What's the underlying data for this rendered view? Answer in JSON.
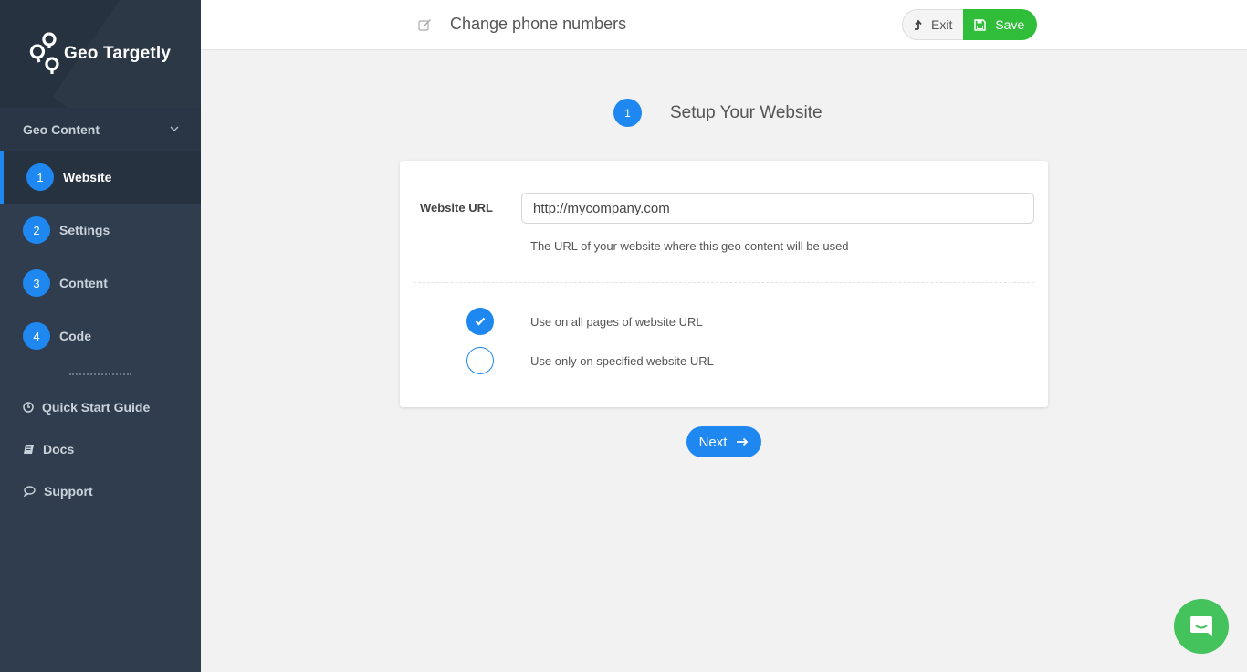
{
  "brand": {
    "name": "Geo Targetly"
  },
  "sidebar": {
    "section_label": "Geo Content",
    "steps": [
      {
        "num": "1",
        "label": "Website"
      },
      {
        "num": "2",
        "label": "Settings"
      },
      {
        "num": "3",
        "label": "Content"
      },
      {
        "num": "4",
        "label": "Code"
      }
    ],
    "links": [
      {
        "icon": "clock-icon",
        "label": "Quick Start Guide"
      },
      {
        "icon": "book-icon",
        "label": "Docs"
      },
      {
        "icon": "chat-icon",
        "label": "Support"
      }
    ]
  },
  "header": {
    "title": "Change phone numbers",
    "exit_label": "Exit",
    "save_label": "Save"
  },
  "stepper": {
    "num": "1",
    "title": "Setup Your Website"
  },
  "form": {
    "url_label": "Website URL",
    "url_value": "http://mycompany.com",
    "url_help": "The URL of your website where this geo content will be used",
    "options": [
      {
        "label": "Use on all pages of website URL",
        "checked": true
      },
      {
        "label": "Use only on specified website URL",
        "checked": false
      }
    ]
  },
  "next_label": "Next",
  "colors": {
    "accent": "#1e88f0",
    "save": "#2fbd3a",
    "sidebar": "#2f3d4e",
    "chat": "#44c35c"
  }
}
